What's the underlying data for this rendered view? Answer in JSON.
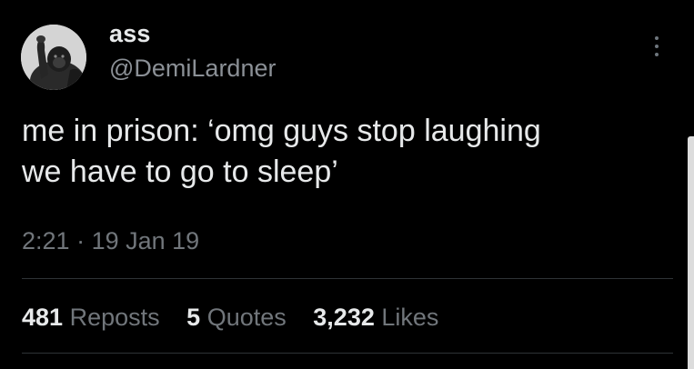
{
  "author": {
    "display_name": "ass",
    "handle": "@DemiLardner",
    "avatar_icon": "gorilla-avatar"
  },
  "tweet": {
    "lines": [
      "me in prison: ‘omg guys stop laughing",
      "we have to go to sleep’"
    ],
    "time": "2:21",
    "separator": "·",
    "date": "19 Jan 19"
  },
  "stats": {
    "reposts": {
      "count": "481",
      "label": "Reposts"
    },
    "quotes": {
      "count": "5",
      "label": "Quotes"
    },
    "likes": {
      "count": "3,232",
      "label": "Likes"
    }
  },
  "colors": {
    "background": "#000000",
    "primary_text": "#e7e9ea",
    "secondary_text": "#71767b",
    "divider": "#2f3336"
  },
  "icons": {
    "more": "more-vertical-icon"
  }
}
